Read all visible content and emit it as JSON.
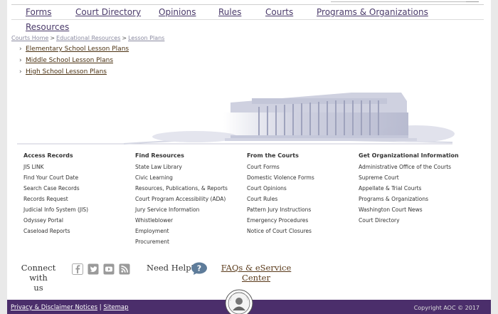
{
  "nav": {
    "items": [
      "Forms",
      "Court Directory",
      "Opinions",
      "Rules",
      "Courts",
      "Programs & Organizations",
      "Resources"
    ]
  },
  "breadcrumb": {
    "items": [
      "Courts Home",
      "Educational Resources",
      "Lesson Plans"
    ],
    "separator": ">"
  },
  "lessons": {
    "items": [
      "Elementary School Lesson Plans",
      "Middle School Lesson Plans",
      "High School Lesson Plans"
    ]
  },
  "footer": {
    "columns": [
      {
        "heading": "Access Records",
        "links": [
          "JIS LINK",
          "Find Your Court Date",
          "Search Case Records",
          "Records Request",
          "Judicial Info System (JIS)",
          "Odyssey Portal",
          "Caseload Reports"
        ]
      },
      {
        "heading": "Find Resources",
        "links": [
          "State Law Library",
          "Civic Learning",
          "Resources, Publications, & Reports",
          "Court Program Accessibility (ADA)",
          "Jury Service Information",
          "Whistleblower",
          "Employment",
          "Procurement"
        ]
      },
      {
        "heading": "From the Courts",
        "links": [
          "Court Forms",
          "Domestic Violence Forms",
          "Court Opinions",
          "Court Rules",
          "Pattern Jury Instructions",
          "Emergency Procedures",
          "Notice of Court Closures"
        ]
      },
      {
        "heading": "Get Organizational Information",
        "links": [
          "Administrative Office of the Courts",
          "Supreme Court",
          "Appellate & Trial Courts",
          "Programs & Organizations",
          "Washington Court News",
          "Court Directory"
        ]
      }
    ],
    "connect": {
      "label_line1": "Connect with",
      "label_line2": "us",
      "icons": [
        "facebook-icon",
        "twitter-icon",
        "youtube-icon",
        "rss-icon"
      ]
    },
    "help": {
      "label": "Need Help?",
      "icon": "question-bubble-icon",
      "faq_line1": "FAQs & eService",
      "faq_line2": "Center"
    },
    "bottom": {
      "privacy": "Privacy & Disclaimer Notices",
      "divider": "|",
      "sitemap": "Sitemap",
      "copyright": "Copyright AOC © 2017"
    }
  },
  "colors": {
    "footer_bar": "#4b2e6b",
    "nav_link": "#4a3a6a",
    "lesson_link": "#4a3010"
  }
}
